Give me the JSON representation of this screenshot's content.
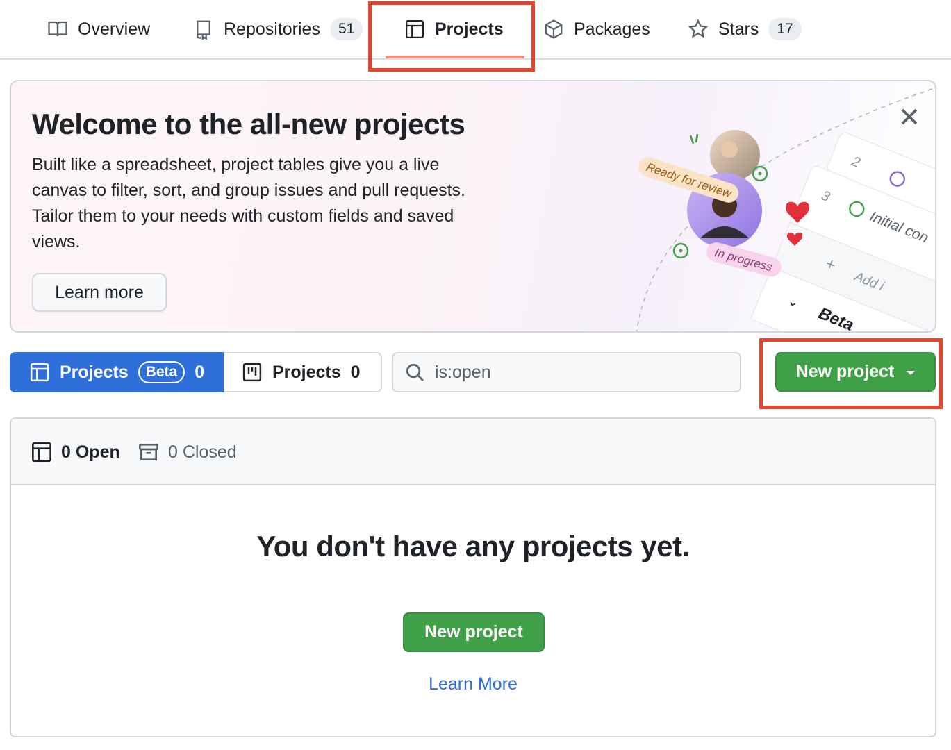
{
  "nav": {
    "tabs": [
      {
        "label": "Overview",
        "icon": "book-icon"
      },
      {
        "label": "Repositories",
        "count": "51",
        "icon": "repo-icon"
      },
      {
        "label": "Projects",
        "icon": "table-icon",
        "active": true
      },
      {
        "label": "Packages",
        "icon": "package-icon"
      },
      {
        "label": "Stars",
        "count": "17",
        "icon": "star-icon"
      }
    ]
  },
  "banner": {
    "title": "Welcome to the all-new projects",
    "text": "Built like a spreadsheet, project tables give you a live canvas to filter, sort, and group issues and pull requests. Tailor them to your needs with custom fields and saved views.",
    "learn_more": "Learn more",
    "illustration": {
      "ready_label": "Ready for review",
      "progress_label": "In progress",
      "row2": "2",
      "row3": "3",
      "initial": "Initial con",
      "add": "Add i",
      "beta": "Beta"
    }
  },
  "filters": {
    "beta_tab": {
      "label": "Projects",
      "badge": "Beta",
      "count": "0"
    },
    "classic_tab": {
      "label": "Projects",
      "count": "0"
    },
    "search_value": "is:open",
    "new_project": "New project"
  },
  "list": {
    "open_label": "0 Open",
    "closed_label": "0 Closed",
    "empty_title": "You don't have any projects yet.",
    "new_project": "New project",
    "learn_more": "Learn More"
  },
  "colors": {
    "primary_green": "#3fa048",
    "accent_blue": "#2f6fd9",
    "highlight_red": "#e5452f",
    "tab_underline": "#fd8c73"
  }
}
